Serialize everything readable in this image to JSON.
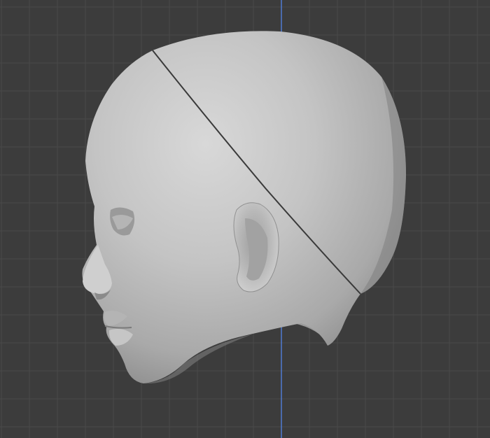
{
  "viewport": {
    "background": "#3c3c3c",
    "grid_color": "#4a4a4a",
    "axis_color": "#4f7bd1",
    "model_color": "#bdbdbd",
    "seam_color": "#3a3a3a"
  }
}
